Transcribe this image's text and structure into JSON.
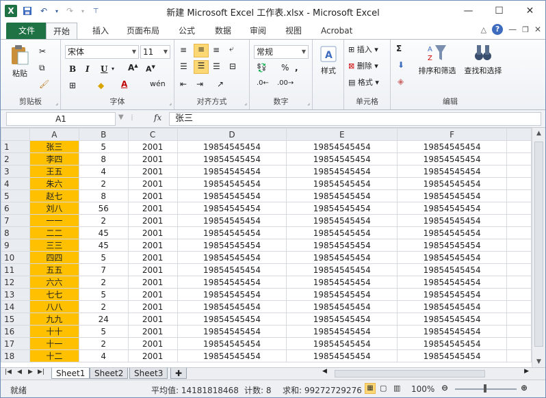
{
  "window": {
    "title": "新建 Microsoft Excel 工作表.xlsx  -  Microsoft Excel"
  },
  "ribbon_tabs": [
    "文件",
    "开始",
    "插入",
    "页面布局",
    "公式",
    "数据",
    "审阅",
    "视图",
    "Acrobat"
  ],
  "ribbon": {
    "clipboard": {
      "paste": "粘贴",
      "label": "剪贴板"
    },
    "font": {
      "name": "宋体",
      "size": "11",
      "label": "字体",
      "bold": "B",
      "italic": "I",
      "underline": "U"
    },
    "alignment": {
      "label": "对齐方式"
    },
    "number": {
      "format": "常规",
      "label": "数字",
      "percent": "%"
    },
    "styles": {
      "button": "样式"
    },
    "cells": {
      "insert": "插入",
      "delete": "删除",
      "format": "格式",
      "label": "单元格"
    },
    "editing": {
      "sum": "Σ",
      "sort": "排序和筛选",
      "find": "查找和选择",
      "label": "编辑"
    }
  },
  "formula_bar": {
    "name_box": "A1",
    "fx": "fx",
    "content": "张三"
  },
  "sheet": {
    "columns": [
      "A",
      "B",
      "C",
      "D",
      "E",
      "F"
    ],
    "rows": [
      {
        "n": "1",
        "a": "张三",
        "b": "5",
        "c": "2001",
        "d": "19854545454",
        "e": "19854545454",
        "f": "19854545454"
      },
      {
        "n": "2",
        "a": "李四",
        "b": "8",
        "c": "2001",
        "d": "19854545454",
        "e": "19854545454",
        "f": "19854545454"
      },
      {
        "n": "3",
        "a": "王五",
        "b": "4",
        "c": "2001",
        "d": "19854545454",
        "e": "19854545454",
        "f": "19854545454"
      },
      {
        "n": "4",
        "a": "朱六",
        "b": "2",
        "c": "2001",
        "d": "19854545454",
        "e": "19854545454",
        "f": "19854545454"
      },
      {
        "n": "5",
        "a": "赵七",
        "b": "8",
        "c": "2001",
        "d": "19854545454",
        "e": "19854545454",
        "f": "19854545454"
      },
      {
        "n": "6",
        "a": "刘八",
        "b": "56",
        "c": "2001",
        "d": "19854545454",
        "e": "19854545454",
        "f": "19854545454"
      },
      {
        "n": "7",
        "a": "一一",
        "b": "2",
        "c": "2001",
        "d": "19854545454",
        "e": "19854545454",
        "f": "19854545454"
      },
      {
        "n": "8",
        "a": "二二",
        "b": "45",
        "c": "2001",
        "d": "19854545454",
        "e": "19854545454",
        "f": "19854545454"
      },
      {
        "n": "9",
        "a": "三三",
        "b": "45",
        "c": "2001",
        "d": "19854545454",
        "e": "19854545454",
        "f": "19854545454"
      },
      {
        "n": "10",
        "a": "四四",
        "b": "5",
        "c": "2001",
        "d": "19854545454",
        "e": "19854545454",
        "f": "19854545454"
      },
      {
        "n": "11",
        "a": "五五",
        "b": "7",
        "c": "2001",
        "d": "19854545454",
        "e": "19854545454",
        "f": "19854545454"
      },
      {
        "n": "12",
        "a": "六六",
        "b": "2",
        "c": "2001",
        "d": "19854545454",
        "e": "19854545454",
        "f": "19854545454"
      },
      {
        "n": "13",
        "a": "七七",
        "b": "5",
        "c": "2001",
        "d": "19854545454",
        "e": "19854545454",
        "f": "19854545454"
      },
      {
        "n": "14",
        "a": "八八",
        "b": "2",
        "c": "2001",
        "d": "19854545454",
        "e": "19854545454",
        "f": "19854545454"
      },
      {
        "n": "15",
        "a": "九九",
        "b": "24",
        "c": "2001",
        "d": "19854545454",
        "e": "19854545454",
        "f": "19854545454"
      },
      {
        "n": "16",
        "a": "十十",
        "b": "5",
        "c": "2001",
        "d": "19854545454",
        "e": "19854545454",
        "f": "19854545454"
      },
      {
        "n": "17",
        "a": "十一",
        "b": "2",
        "c": "2001",
        "d": "19854545454",
        "e": "19854545454",
        "f": "19854545454"
      },
      {
        "n": "18",
        "a": "十二",
        "b": "4",
        "c": "2001",
        "d": "19854545454",
        "e": "19854545454",
        "f": "19854545454"
      }
    ]
  },
  "sheet_tabs": [
    "Sheet1",
    "Sheet2",
    "Sheet3"
  ],
  "status": {
    "ready": "就绪",
    "average": "平均值: 14181818468",
    "count": "计数: 8",
    "sum": "求和: 99272729276",
    "zoom": "100%"
  },
  "colors": {
    "highlight": "#ffc000",
    "file_tab": "#1f7244"
  }
}
